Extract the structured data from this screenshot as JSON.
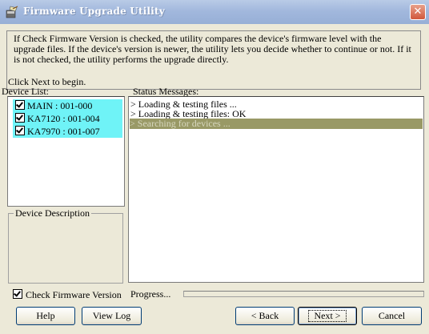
{
  "window": {
    "title": "Firmware Upgrade Utility",
    "close_glyph": "✕"
  },
  "intro": {
    "text": "If Check Firmware Version is checked, the utility compares the device's firmware level with the upgrade files. If the device's version is newer, the utility lets you decide whether to continue or not. If it is not checked, the utility performs the upgrade directly.",
    "click_next": "Click Next to begin."
  },
  "device_list": {
    "label": "Device List:",
    "items": [
      {
        "label": "MAIN : 001-000",
        "checked": true
      },
      {
        "label": "KA7120 : 001-004",
        "checked": true
      },
      {
        "label": "KA7970 : 001-007",
        "checked": true
      }
    ]
  },
  "device_description": {
    "label": "Device Description"
  },
  "status": {
    "label": "Status Messages:",
    "messages": [
      "> Loading & testing files ...",
      "> Loading & testing files: OK",
      "> Searching for devices ..."
    ],
    "selected_index": 2
  },
  "check_firmware": {
    "label": "Check Firmware Version",
    "checked": true
  },
  "progress": {
    "label": "Progress...",
    "value_percent": 0
  },
  "buttons": {
    "help": "Help",
    "view_log": "View Log",
    "back": "< Back",
    "next": "Next >",
    "cancel": "Cancel"
  },
  "colors": {
    "device_highlight": "#6ff3f7",
    "status_selected": "#999966",
    "titlebar": "#a2b8dd",
    "dialog_bg": "#ece9d8"
  }
}
